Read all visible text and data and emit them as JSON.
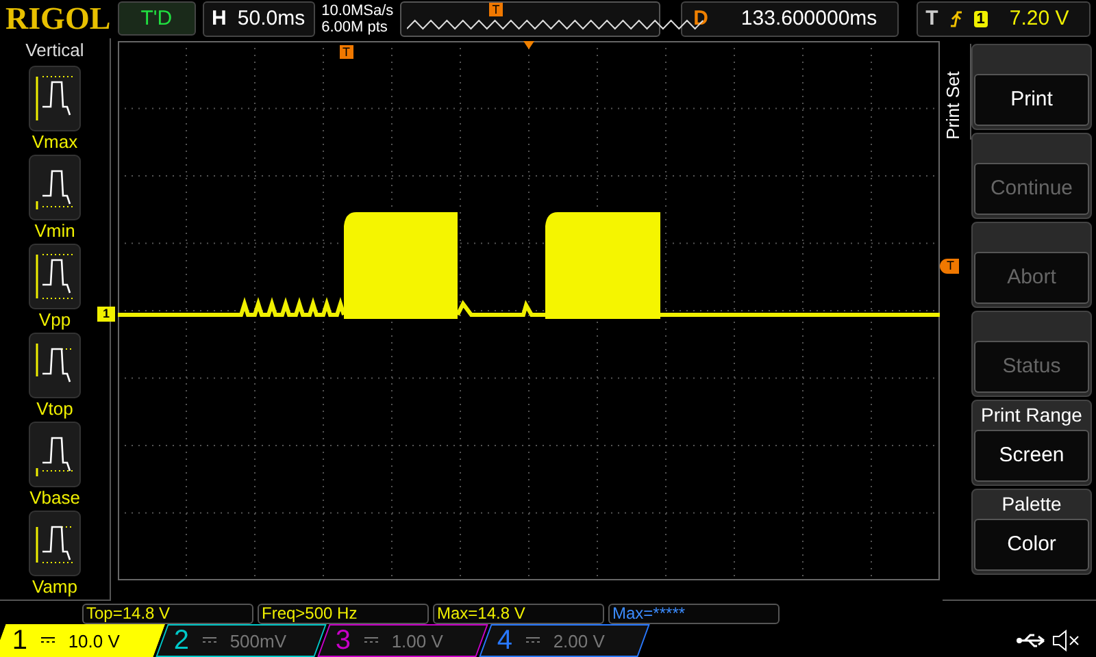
{
  "brand": "RIGOL",
  "run_status": "T'D",
  "horizontal": {
    "label": "H",
    "timebase": "50.0ms",
    "sample_rate": "10.0MSa/s",
    "memory_depth": "6.00M pts",
    "trigger_marker": "T"
  },
  "delay": {
    "label": "D",
    "value": "133.600000ms"
  },
  "trigger": {
    "label": "T",
    "channel": "1",
    "level": "7.20 V"
  },
  "left_menu": {
    "title": "Vertical",
    "items": [
      {
        "label": "Vmax",
        "kind": "max"
      },
      {
        "label": "Vmin",
        "kind": "min"
      },
      {
        "label": "Vpp",
        "kind": "pp"
      },
      {
        "label": "Vtop",
        "kind": "top"
      },
      {
        "label": "Vbase",
        "kind": "base"
      },
      {
        "label": "Vamp",
        "kind": "amp"
      }
    ]
  },
  "screen": {
    "trigger_position_marker": "T",
    "channel_marker": "1",
    "trigger_level_marker": "T"
  },
  "right_menu": {
    "title": "Print Set",
    "items": [
      {
        "value": "Print",
        "disabled": false
      },
      {
        "value": "Continue",
        "disabled": true
      },
      {
        "value": "Abort",
        "disabled": true
      },
      {
        "value": "Status",
        "disabled": true
      },
      {
        "label": "Print Range",
        "value": "Screen",
        "disabled": false
      },
      {
        "label": "Palette",
        "value": "Color",
        "disabled": false
      }
    ]
  },
  "measurements": [
    {
      "text": "Top=14.8 V",
      "color": "#f0f000"
    },
    {
      "text": "Freq>500 Hz",
      "color": "#f0f000"
    },
    {
      "text": "Max=14.8 V",
      "color": "#f0f000"
    },
    {
      "text": "Max=*****",
      "color": "#3c8cff"
    }
  ],
  "channels": [
    {
      "number": "1",
      "scale": "10.0 V",
      "on": true,
      "color": "#ffff00"
    },
    {
      "number": "2",
      "scale": "500mV",
      "on": false,
      "color": "#00c8c8"
    },
    {
      "number": "3",
      "scale": "1.00 V",
      "on": false,
      "color": "#c800c8"
    },
    {
      "number": "4",
      "scale": "2.00 V",
      "on": false,
      "color": "#2878ff"
    }
  ]
}
